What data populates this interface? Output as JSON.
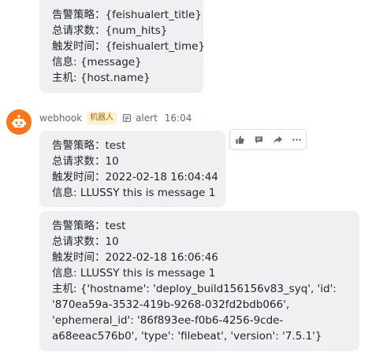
{
  "message_top": {
    "lines": [
      "告警策略：{feishualert_title}",
      "总请求数：{num_hits}",
      "触发时间：{feishualert_time}",
      "信息: {message}",
      "主机: {host.name}"
    ]
  },
  "sender": {
    "name": "webhook",
    "tag": "机器人",
    "subject": "alert",
    "time": "16:04"
  },
  "message_2": {
    "lines": [
      "告警策略：test",
      "总请求数：10",
      "触发时间：2022-02-18 16:04:44",
      "信息: LLUSSY this is message 1"
    ]
  },
  "message_3": {
    "lines": [
      "告警策略：test",
      "总请求数：10",
      "触发时间：2022-02-18 16:06:46",
      "信息: LLUSSY this is message 1",
      "主机: {'hostname': 'deploy_build156156v83_syq', 'id':",
      "'870ea59a-3532-419b-9268-032fd2bdb066',",
      "'ephemeral_id': '86f893ee-f0b6-4256-9cde-",
      "a68eeac576b0', 'type': 'filebeat', 'version': '7.5.1'}"
    ]
  },
  "toolbar": {
    "icons": [
      "thumbs-up-icon",
      "comment-icon",
      "forward-icon",
      "more-icon"
    ]
  },
  "colors": {
    "bubble": "#eff0f1",
    "avatar": "#f8761c",
    "tag_bg": "#fdf1d1",
    "tag_text": "#a2690c",
    "meta_text": "#646a73"
  }
}
